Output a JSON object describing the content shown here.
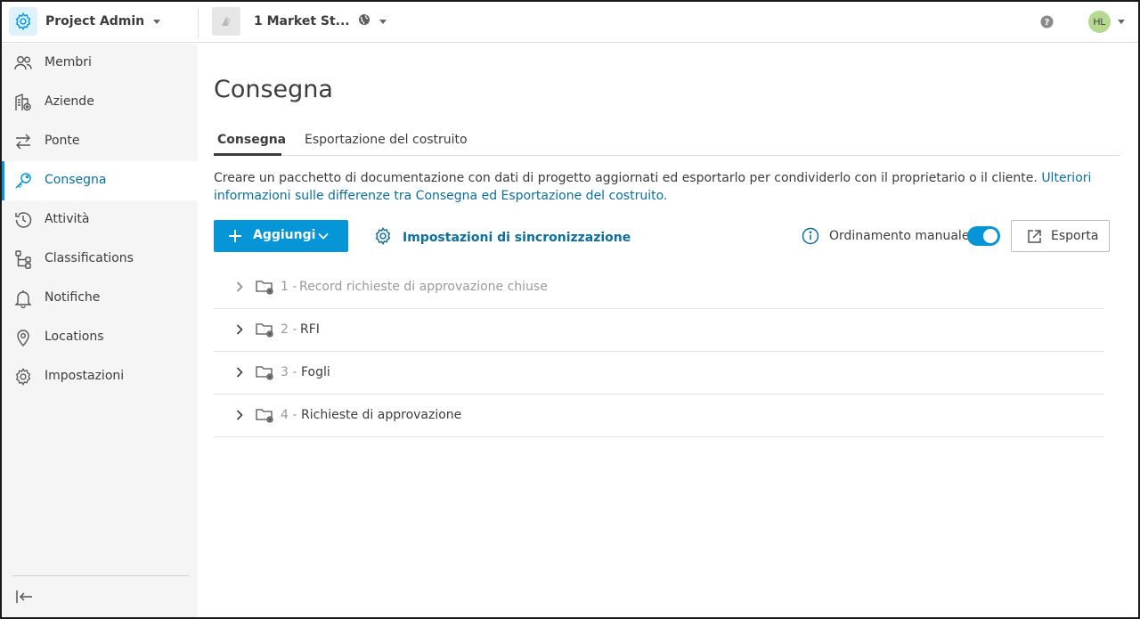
{
  "header": {
    "app_name": "Project Admin",
    "project_name": "1 Market St...",
    "avatar_initials": "HL"
  },
  "sidebar": {
    "items": [
      {
        "label": "Membri",
        "icon": "users-icon"
      },
      {
        "label": "Aziende",
        "icon": "building-icon"
      },
      {
        "label": "Ponte",
        "icon": "bridge-arrows-icon"
      },
      {
        "label": "Consegna",
        "icon": "key-icon",
        "active": true
      },
      {
        "label": "Attività",
        "icon": "history-icon"
      },
      {
        "label": "Classifications",
        "icon": "hierarchy-icon"
      },
      {
        "label": "Notifiche",
        "icon": "bell-icon"
      },
      {
        "label": "Locations",
        "icon": "location-pin-icon"
      },
      {
        "label": "Impostazioni",
        "icon": "gear-icon"
      }
    ]
  },
  "main": {
    "title": "Consegna",
    "tabs": [
      {
        "label": "Consegna",
        "active": true
      },
      {
        "label": "Esportazione del costruito"
      }
    ],
    "description": "Creare un pacchetto di documentazione con dati di progetto aggiornati ed esportarlo per condividerlo con il proprietario o il cliente.",
    "description_link_1": "Ulteriori",
    "description_link_2": "informazioni sulle differenze tra Consegna ed Esportazione del costruito.",
    "add_button": "Aggiungi",
    "sync_settings": "Impostazioni di sincronizzazione",
    "manual_sort_label": "Ordinamento manuale",
    "manual_sort_on": true,
    "export_button": "Esporta",
    "folders": [
      {
        "number": "1 -",
        "name": "Record richieste di approvazione chiuse",
        "muted": true
      },
      {
        "number": "2 -",
        "name": "RFI"
      },
      {
        "number": "3 -",
        "name": "Fogli"
      },
      {
        "number": "4 -",
        "name": "Richieste di approvazione"
      }
    ]
  },
  "colors": {
    "accent": "#0696d7",
    "link": "#0a6fa0",
    "sidebar_bg": "#f5f5f5"
  }
}
